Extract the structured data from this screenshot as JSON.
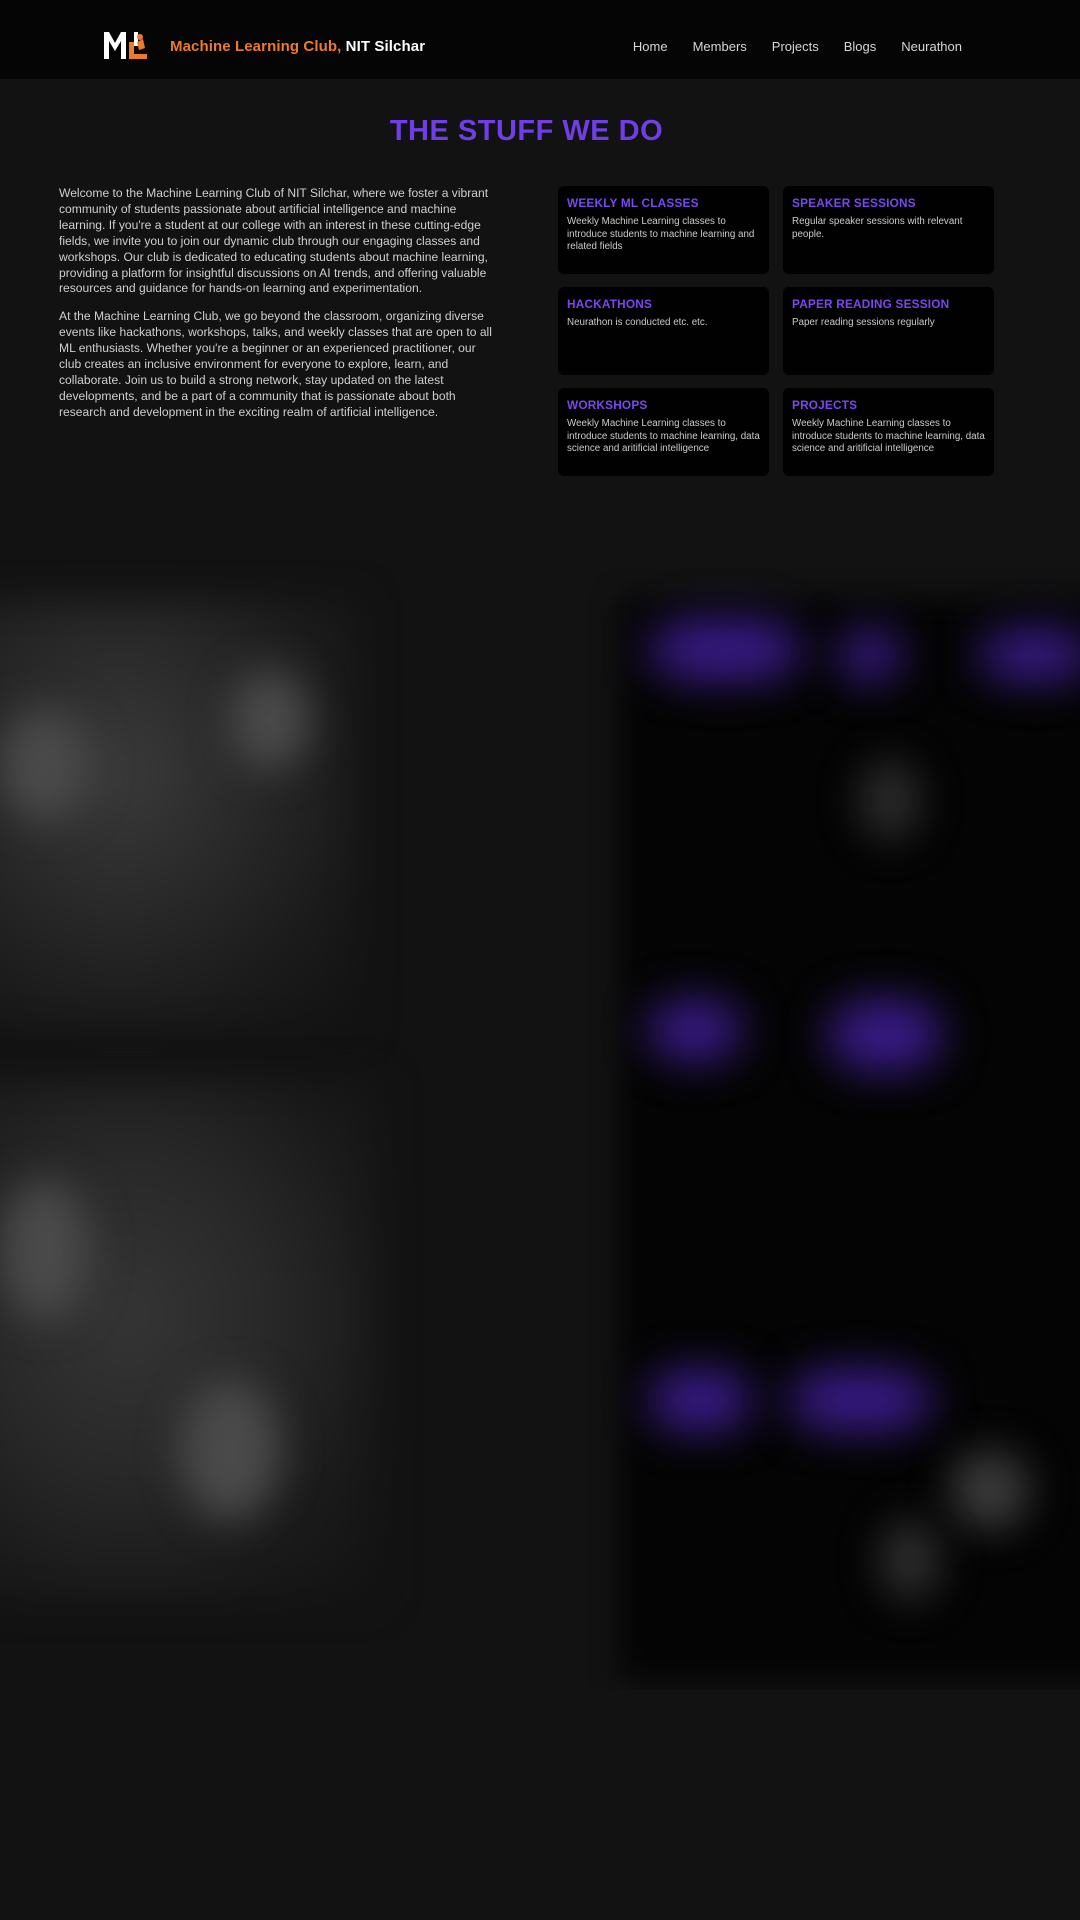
{
  "brand": {
    "logo_text": "ML",
    "club_name": "Machine Learning Club,",
    "institute": "NIT Silchar"
  },
  "nav": {
    "items": [
      {
        "label": "Home"
      },
      {
        "label": "Members"
      },
      {
        "label": "Projects"
      },
      {
        "label": "Blogs"
      },
      {
        "label": "Neurathon"
      }
    ]
  },
  "section": {
    "title": "THE STUFF WE DO",
    "paragraphs": [
      "Welcome to the Machine Learning Club of NIT Silchar, where we foster a vibrant community of students passionate about artificial intelligence and machine learning. If you're a student at our college with an interest in these cutting-edge fields, we invite you to join our dynamic club through our engaging classes and workshops. Our club is dedicated to educating students about machine learning, providing a platform for insightful discussions on AI trends, and offering valuable resources and guidance for hands-on learning and experimentation.",
      "At the Machine Learning Club, we go beyond the classroom, organizing diverse events like hackathons, workshops, talks, and weekly classes that are open to all ML enthusiasts. Whether you're a beginner or an experienced practitioner, our club creates an inclusive environment for everyone to explore, learn, and collaborate. Join us to build a strong network, stay updated on the latest developments, and be a part of a community that is passionate about both research and development in the exciting realm of artificial intelligence."
    ]
  },
  "cards": [
    {
      "title": "WEEKLY ML CLASSES",
      "desc": "Weekly Machine Learning classes to introduce students to machine learning and related fields"
    },
    {
      "title": "SPEAKER SESSIONS",
      "desc": "Regular speaker sessions with relevant people."
    },
    {
      "title": "HACKATHONS",
      "desc": "Neurathon is conducted etc. etc."
    },
    {
      "title": "PAPER READING SESSION",
      "desc": "Paper reading sessions regularly"
    },
    {
      "title": "WORKSHOPS",
      "desc": "Weekly Machine Learning classes to introduce students to machine learning, data science and aritificial intelligence"
    },
    {
      "title": "PROJECTS",
      "desc": "Weekly Machine Learning classes to introduce students to machine learning, data science and aritificial intelligence"
    }
  ],
  "colors": {
    "accent": "#6f3ee6",
    "brand_orange": "#ec7a2c",
    "background": "#121212",
    "navbar": "#050505",
    "card": "#010101"
  }
}
